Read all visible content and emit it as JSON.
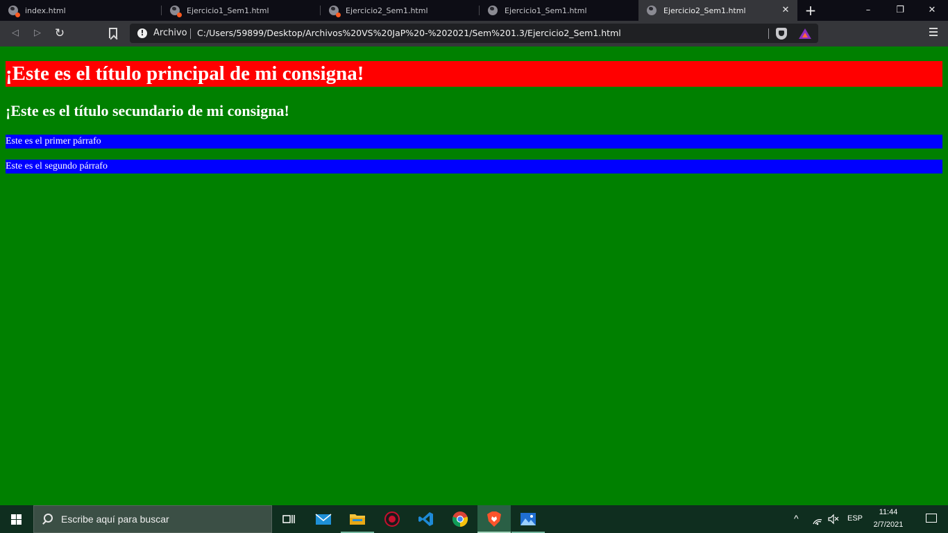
{
  "browser": {
    "tabs": [
      {
        "title": "index.html",
        "active": false,
        "notification_dot": true
      },
      {
        "title": "Ejercicio1_Sem1.html",
        "active": false,
        "notification_dot": true
      },
      {
        "title": "Ejercicio2_Sem1.html",
        "active": false,
        "notification_dot": true
      },
      {
        "title": "Ejercicio1_Sem1.html",
        "active": false,
        "notification_dot": false
      },
      {
        "title": "Ejercicio2_Sem1.html",
        "active": true,
        "notification_dot": false
      }
    ],
    "close_tab_glyph": "✕",
    "new_tab_glyph": "+",
    "window_controls": {
      "minimize": "–",
      "restore": "❐",
      "close": "✕"
    },
    "nav": {
      "back": "◁",
      "forward": "▷",
      "reload": "↻"
    },
    "site_info_label": "Archivo",
    "info_glyph": "!",
    "url": "C:/Users/59899/Desktop/Archivos%20VS%20JaP%20-%202021/Sem%201.3/Ejercicio2_Sem1.html",
    "extension_icons": [
      "brave-shields-icon",
      "brave-rewards-icon"
    ],
    "colors": {
      "tabstrip": "#0d0d15",
      "toolbar": "#35363a",
      "omnibox": "#1f2023",
      "tab_dot": "#ff5a1f"
    }
  },
  "page": {
    "heading1": "¡Este es el título principal de mi consigna!",
    "heading2": "¡Este es el título secundario de mi consigna!",
    "paragraph1": "Este es el primer párrafo",
    "paragraph2": "Este es el segundo párrafo",
    "colors": {
      "background": "#008000",
      "heading1_bg": "#ff0000",
      "paragraph_bg": "#0000ff",
      "text": "#ffffff"
    }
  },
  "taskbar": {
    "search_placeholder": "Escribe aquí para buscar",
    "apps": [
      "task-view-icon",
      "mail-icon",
      "file-explorer-icon",
      "gaming-app-icon",
      "vscode-icon",
      "chrome-icon",
      "brave-icon",
      "photos-icon"
    ],
    "tray": {
      "chevron": "^",
      "language": "ESP",
      "time": "11:44",
      "date": "2/7/2021"
    },
    "colors": {
      "background": "#0f2e1f",
      "search_bg": "#3b4f45"
    }
  }
}
